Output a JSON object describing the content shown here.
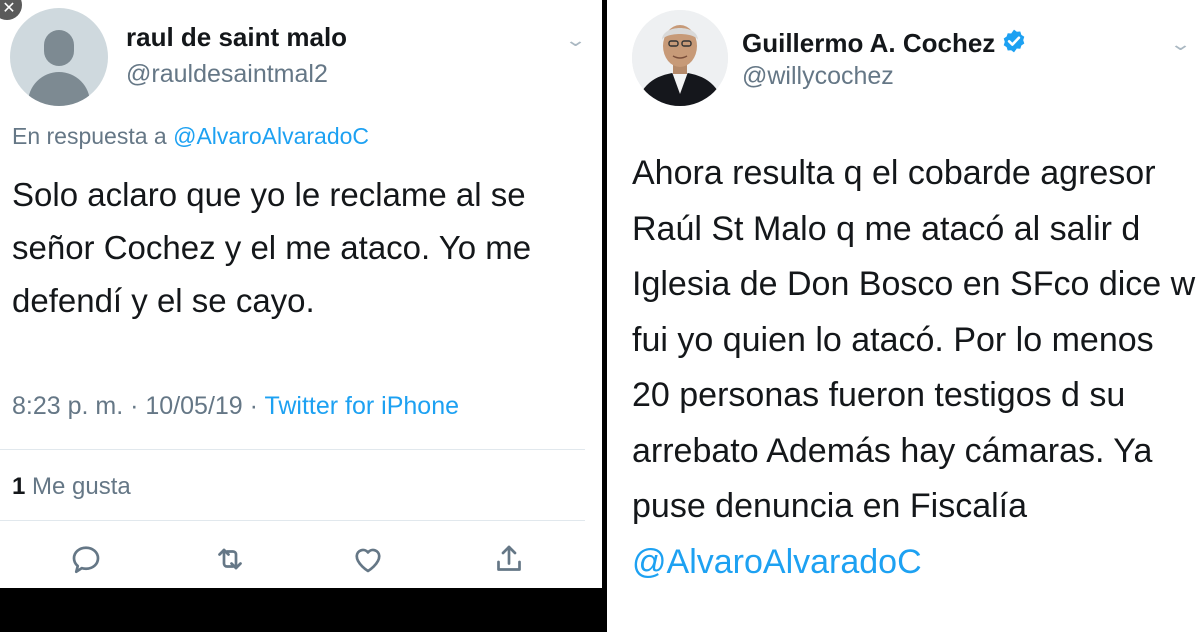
{
  "left_tweet": {
    "close_glyph": "✕",
    "author_name": "raul de saint malo",
    "author_handle": "@rauldesaintmal2",
    "reply_prefix": "En respuesta a",
    "reply_mention": "@AlvaroAlvaradoC",
    "text": "Solo aclaro que yo le reclame al se señor Cochez y el me ataco. Yo me defendí y el se cayo.",
    "timestamp": "8:23 p. m. · 10/05/19 · ",
    "source": "Twitter for iPhone",
    "likes_count": "1",
    "likes_label": "Me gusta",
    "actions": [
      "reply-icon",
      "retweet-icon",
      "like-icon",
      "share-icon"
    ]
  },
  "right_tweet": {
    "author_name": "Guillermo A. Cochez",
    "author_handle": "@willycochez",
    "text": "Ahora resulta q el cobarde agresor Raúl St Malo q me atacó al salir d Iglesia de Don Bosco en SFco dice w fui yo quien lo atacó. Por lo menos 20 personas fueron testigos d su arrebato Además hay cámaras. Ya puse denuncia en Fiscalía ",
    "mention": "@AlvaroAlvaradoC"
  },
  "colors": {
    "link": "#1da1f2",
    "secondary_text": "#657786",
    "primary_text": "#14171a",
    "verified": "#1da1f2"
  }
}
